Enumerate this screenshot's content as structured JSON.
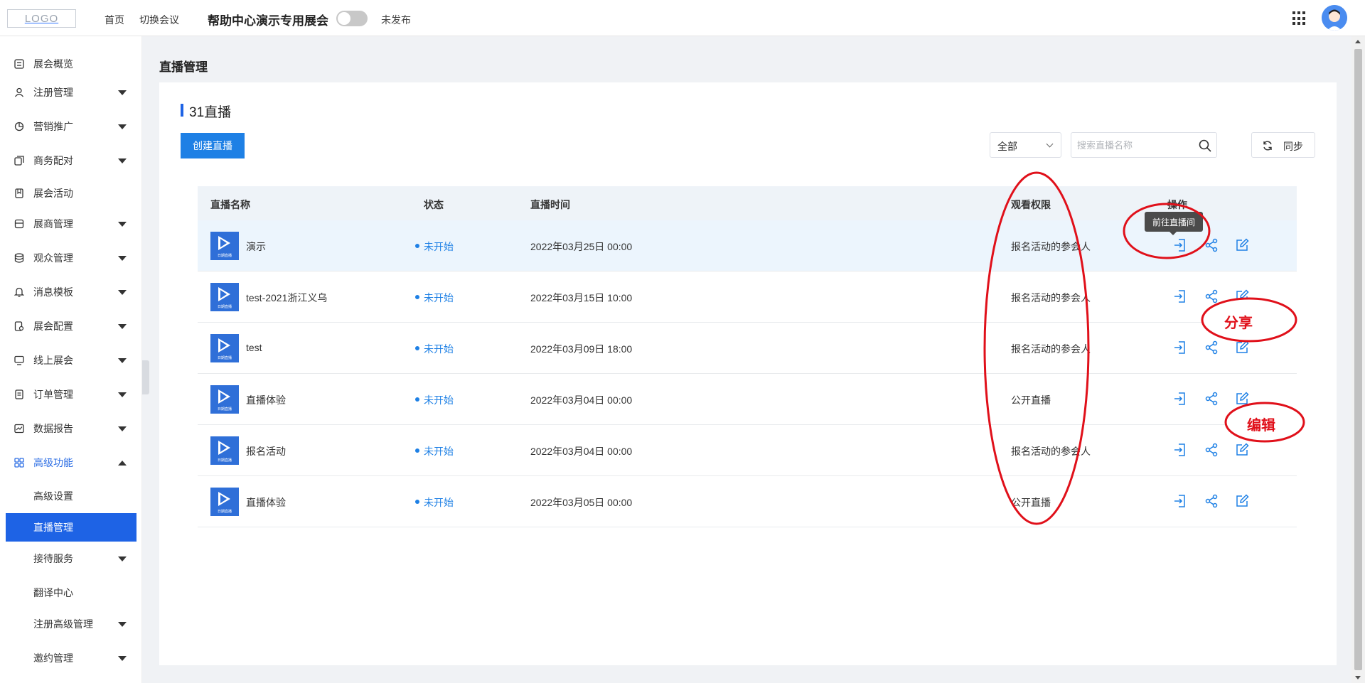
{
  "header": {
    "logo_text": "LOGO",
    "nav_home": "首页",
    "nav_switch": "切换会议",
    "expo_title": "帮助中心演示专用展会",
    "publish_status": "未发布",
    "publish_toggle_on": false
  },
  "sidebar": {
    "items": [
      {
        "label": "展会概览",
        "icon": "dashboard-icon",
        "has_caret": false
      },
      {
        "label": "注册管理",
        "icon": "user-icon",
        "has_caret": true
      },
      {
        "label": "营销推广",
        "icon": "pie-chart-icon",
        "has_caret": true
      },
      {
        "label": "商务配对",
        "icon": "copy-icon",
        "has_caret": true
      },
      {
        "label": "展会活动",
        "icon": "bookmark-icon",
        "has_caret": false
      },
      {
        "label": "展商管理",
        "icon": "archive-icon",
        "has_caret": true
      },
      {
        "label": "观众管理",
        "icon": "database-icon",
        "has_caret": true
      },
      {
        "label": "消息模板",
        "icon": "bell-icon",
        "has_caret": true
      },
      {
        "label": "展会配置",
        "icon": "settings-doc-icon",
        "has_caret": true
      },
      {
        "label": "线上展会",
        "icon": "monitor-icon",
        "has_caret": true
      },
      {
        "label": "订单管理",
        "icon": "list-icon",
        "has_caret": true
      },
      {
        "label": "数据报告",
        "icon": "chart-icon",
        "has_caret": true
      },
      {
        "label": "高级功能",
        "icon": "grid-icon",
        "has_caret": true,
        "expanded": true
      }
    ],
    "sub_items": [
      {
        "label": "高级设置",
        "has_caret": false
      },
      {
        "label": "直播管理",
        "has_caret": false,
        "selected": true
      },
      {
        "label": "接待服务",
        "has_caret": true
      },
      {
        "label": "翻译中心",
        "has_caret": false
      },
      {
        "label": "注册高级管理",
        "has_caret": true
      },
      {
        "label": "邀约管理",
        "has_caret": true
      }
    ]
  },
  "main": {
    "page_title": "直播管理",
    "section_title": "31直播",
    "create_button": "创建直播",
    "filter_value": "全部",
    "search_placeholder": "搜索直播名称",
    "sync_button": "同步",
    "table": {
      "headers": [
        "直播名称",
        "状态",
        "直播时间",
        "观看权限",
        "操作"
      ],
      "rows": [
        {
          "name": "演示",
          "status": "未开始",
          "time": "2022年03月25日 00:00",
          "permission": "报名活动的参会人"
        },
        {
          "name": "test-2021浙江义乌",
          "status": "未开始",
          "time": "2022年03月15日 10:00",
          "permission": "报名活动的参会人"
        },
        {
          "name": "test",
          "status": "未开始",
          "time": "2022年03月09日 18:00",
          "permission": "报名活动的参会人"
        },
        {
          "name": "直播体验",
          "status": "未开始",
          "time": "2022年03月04日 00:00",
          "permission": "公开直播"
        },
        {
          "name": "报名活动",
          "status": "未开始",
          "time": "2022年03月04日 00:00",
          "permission": "报名活动的参会人"
        },
        {
          "name": "直播体验",
          "status": "未开始",
          "time": "2022年03月05日 00:00",
          "permission": "公开直播"
        }
      ],
      "thumb_caption": "日期直播",
      "tooltip": "前往直播间"
    }
  },
  "annotations": {
    "share_label": "分享",
    "edit_label": "编辑",
    "color": "#e0101a"
  },
  "colors": {
    "primary": "#1e63e5",
    "button": "#1e80e5",
    "status": "#1e80e5"
  }
}
